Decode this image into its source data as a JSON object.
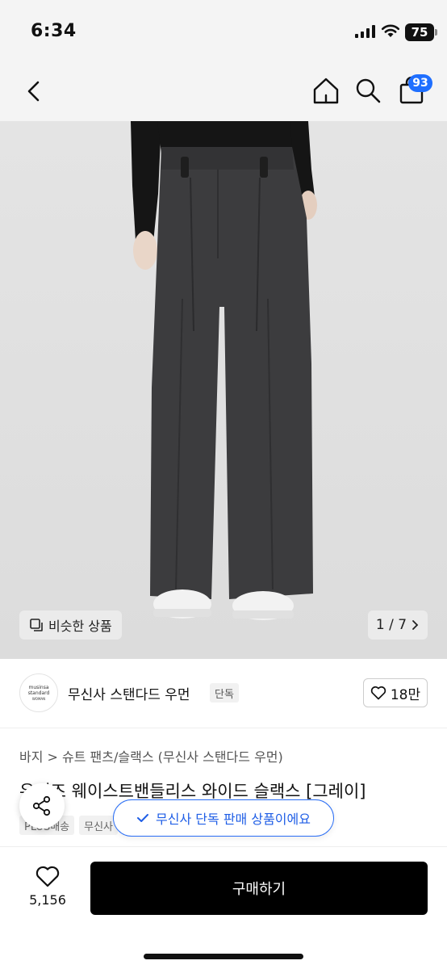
{
  "status_bar": {
    "time": "6:34",
    "battery": "75"
  },
  "nav": {
    "cart_count": "93",
    "icons": [
      "back-arrow",
      "home",
      "search",
      "shopping-bag"
    ]
  },
  "gallery": {
    "similar_label": "비슷한 상품",
    "page_counter": "1 / 7",
    "colors": {
      "pants": "#3c3c3e",
      "top": "#151515",
      "background": "#dedede"
    }
  },
  "brand": {
    "logo_line1": "musinsa",
    "logo_line2": "standard",
    "logo_line3": "WOMAN",
    "name": "무신사 스탠다드 우먼",
    "tag": "단독",
    "like_count": "18만"
  },
  "product": {
    "breadcrumb": "바지 > 슈트 팬츠/슬랙스 (무신사 스탠다드 우먼)",
    "title": "우먼즈 웨이스트밴들리스 와이드 슬랙스 [그레이]",
    "tags": [
      "PLUS배송",
      "무신사"
    ]
  },
  "toast": {
    "text": "무신사 단독 판매 상품이에요",
    "accent": "#1f5ee6"
  },
  "bottom": {
    "like_count": "5,156",
    "buy_label": "구매하기"
  }
}
